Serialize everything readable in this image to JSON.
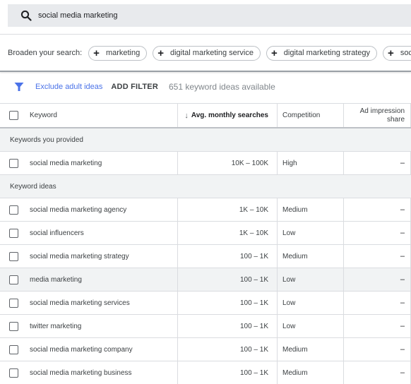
{
  "search": {
    "value": "social media marketing",
    "icon": "search-icon"
  },
  "broaden": {
    "label": "Broaden your search:",
    "chips": [
      {
        "label": "marketing"
      },
      {
        "label": "digital marketing service"
      },
      {
        "label": "digital marketing strategy"
      },
      {
        "label": "social ma"
      }
    ]
  },
  "filters": {
    "icon": "filter-icon",
    "exclude_label": "Exclude adult ideas",
    "add_filter_label": "ADD FILTER",
    "count_label": "651 keyword ideas available",
    "accent_color": "#4a72e8"
  },
  "table": {
    "columns": {
      "keyword": "Keyword",
      "sort_arrow": "↓",
      "avg": "Avg. monthly searches",
      "competition": "Competition",
      "ad_share": "Ad impression share"
    },
    "groups": [
      {
        "label": "Keywords you provided",
        "rows": [
          {
            "keyword": "social media marketing",
            "avg": "10K – 100K",
            "competition": "High",
            "ad_share": "–"
          }
        ]
      },
      {
        "label": "Keyword ideas",
        "rows": [
          {
            "keyword": "social media marketing agency",
            "avg": "1K – 10K",
            "competition": "Medium",
            "ad_share": "–"
          },
          {
            "keyword": "social influencers",
            "avg": "1K – 10K",
            "competition": "Low",
            "ad_share": "–"
          },
          {
            "keyword": "social media marketing strategy",
            "avg": "100 – 1K",
            "competition": "Medium",
            "ad_share": "–"
          },
          {
            "keyword": "media marketing",
            "avg": "100 – 1K",
            "competition": "Low",
            "ad_share": "–"
          },
          {
            "keyword": "social media marketing services",
            "avg": "100 – 1K",
            "competition": "Low",
            "ad_share": "–"
          },
          {
            "keyword": "twitter marketing",
            "avg": "100 – 1K",
            "competition": "Low",
            "ad_share": "–"
          },
          {
            "keyword": "social media marketing company",
            "avg": "100 – 1K",
            "competition": "Medium",
            "ad_share": "–"
          },
          {
            "keyword": "social media marketing business",
            "avg": "100 – 1K",
            "competition": "Medium",
            "ad_share": "–"
          }
        ]
      }
    ]
  }
}
